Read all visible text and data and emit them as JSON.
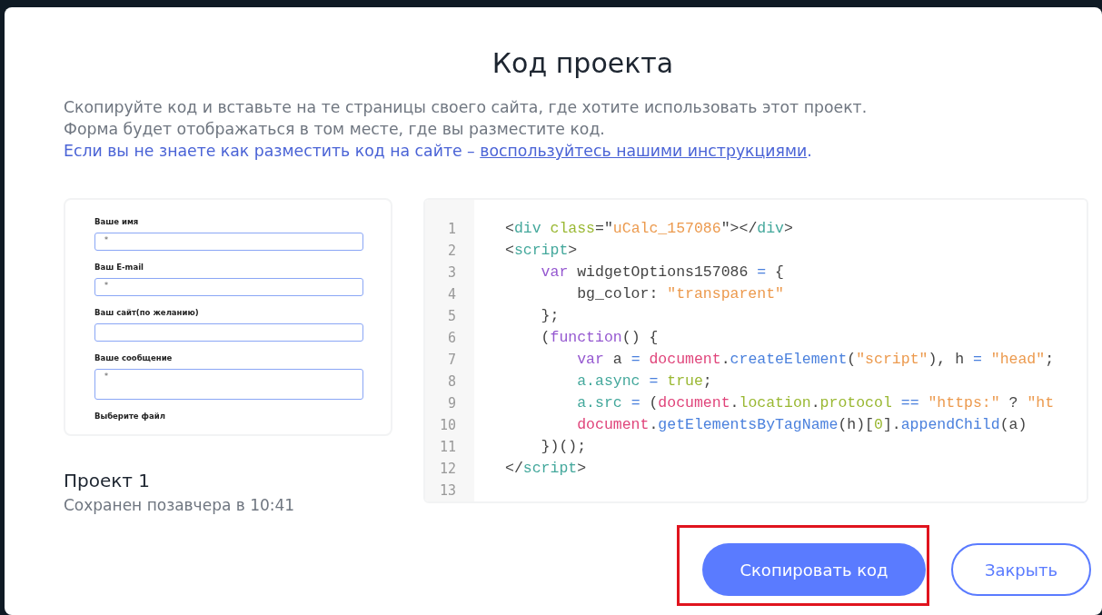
{
  "dialog": {
    "title": "Код проекта",
    "intro": [
      "Скопируйте код и вставьте на те страницы своего сайта, где хотите использовать этот проект.",
      "Форма будет отображаться в том месте, где вы разместите код."
    ],
    "help": {
      "text": "Если вы не знаете как разместить код на сайте – ",
      "link": "воспользуйтесь нашими инструкциями",
      "end": "."
    },
    "preview": {
      "fields": [
        {
          "kind": "input",
          "label": "Ваше имя",
          "value": "*"
        },
        {
          "kind": "input",
          "label": "Ваш E-mail",
          "value": "*"
        },
        {
          "kind": "input",
          "label": "Ваш сайт(по желанию)"
        },
        {
          "kind": "textarea",
          "label": "Ваше сообщение",
          "value": "*"
        },
        {
          "kind": "label",
          "label": "Выберите файл"
        }
      ]
    },
    "project": {
      "name": "Проект 1",
      "saved": "Сохранен позавчера в 10:41"
    },
    "code": [
      {
        "number": "1",
        "tokens": [
          {
            "kind": "p",
            "text": "<"
          },
          {
            "kind": "tag",
            "text": "div "
          },
          {
            "kind": "attr",
            "text": "class"
          },
          {
            "kind": "p",
            "text": "=\""
          },
          {
            "kind": "str",
            "text": "uCalc_157086"
          },
          {
            "kind": "p",
            "text": "\"></"
          },
          {
            "kind": "tag",
            "text": "div"
          },
          {
            "kind": "p",
            "text": ">"
          }
        ]
      },
      {
        "number": "2",
        "tokens": [
          {
            "kind": "p",
            "text": "<"
          },
          {
            "kind": "tag",
            "text": "script"
          },
          {
            "kind": "p",
            "text": ">"
          }
        ]
      },
      {
        "number": "3",
        "tokens": [
          {
            "kind": "kw",
            "text": "    var"
          },
          {
            "kind": "p",
            "text": " widgetOptions157086"
          },
          {
            "kind": "op",
            "text": " = "
          },
          {
            "kind": "p",
            "text": "{"
          }
        ]
      },
      {
        "number": "4",
        "tokens": [
          {
            "kind": "p",
            "text": "        bg_color: "
          },
          {
            "kind": "str",
            "text": "\"transparent\""
          }
        ]
      },
      {
        "number": "5",
        "tokens": [
          {
            "kind": "p",
            "text": "    };"
          }
        ]
      },
      {
        "number": "6",
        "tokens": [
          {
            "kind": "p",
            "text": "    ("
          },
          {
            "kind": "kw",
            "text": "function"
          },
          {
            "kind": "p",
            "text": "() {"
          }
        ]
      },
      {
        "number": "7",
        "tokens": [
          {
            "kind": "kw",
            "text": "        var"
          },
          {
            "kind": "p",
            "text": " a"
          },
          {
            "kind": "op",
            "text": " = "
          },
          {
            "kind": "obj",
            "text": "document"
          },
          {
            "kind": "p",
            "text": "."
          },
          {
            "kind": "fn",
            "text": "createElement"
          },
          {
            "kind": "p",
            "text": "("
          },
          {
            "kind": "str",
            "text": "\"script\""
          },
          {
            "kind": "p",
            "text": "), h"
          },
          {
            "kind": "op",
            "text": " = "
          },
          {
            "kind": "str",
            "text": "\"head\""
          },
          {
            "kind": "p",
            "text": ";"
          }
        ]
      },
      {
        "number": "8",
        "tokens": [
          {
            "kind": "prop",
            "text": "        a.async"
          },
          {
            "kind": "op",
            "text": " = "
          },
          {
            "kind": "lit",
            "text": "true"
          },
          {
            "kind": "p",
            "text": ";"
          }
        ]
      },
      {
        "number": "9",
        "tokens": [
          {
            "kind": "prop",
            "text": "        a.src"
          },
          {
            "kind": "op",
            "text": " = "
          },
          {
            "kind": "p",
            "text": "("
          },
          {
            "kind": "obj",
            "text": "document"
          },
          {
            "kind": "p",
            "text": "."
          },
          {
            "kind": "lit",
            "text": "location"
          },
          {
            "kind": "p",
            "text": "."
          },
          {
            "kind": "lit",
            "text": "protocol"
          },
          {
            "kind": "op",
            "text": " == "
          },
          {
            "kind": "str",
            "text": "\"https:\""
          },
          {
            "kind": "p",
            "text": " ? "
          },
          {
            "kind": "str",
            "text": "\"ht"
          }
        ]
      },
      {
        "number": "10",
        "tokens": [
          {
            "kind": "obj",
            "text": "        document"
          },
          {
            "kind": "p",
            "text": "."
          },
          {
            "kind": "fn",
            "text": "getElementsByTagName"
          },
          {
            "kind": "p",
            "text": "(h)["
          },
          {
            "kind": "lit",
            "text": "0"
          },
          {
            "kind": "p",
            "text": "]."
          },
          {
            "kind": "fn",
            "text": "appendChild"
          },
          {
            "kind": "p",
            "text": "(a)"
          }
        ]
      },
      {
        "number": "11",
        "tokens": [
          {
            "kind": "p",
            "text": "    })();"
          }
        ]
      },
      {
        "number": "12",
        "tokens": [
          {
            "kind": "p",
            "text": "</"
          },
          {
            "kind": "tag",
            "text": "script"
          },
          {
            "kind": "p",
            "text": ">"
          }
        ]
      },
      {
        "number": "13"
      }
    ],
    "buttons": [
      {
        "kind": "primary",
        "label": "Скопировать код",
        "highlighted": true
      },
      {
        "kind": "secondary",
        "label": "Закрыть",
        "highlighted": false
      }
    ]
  }
}
